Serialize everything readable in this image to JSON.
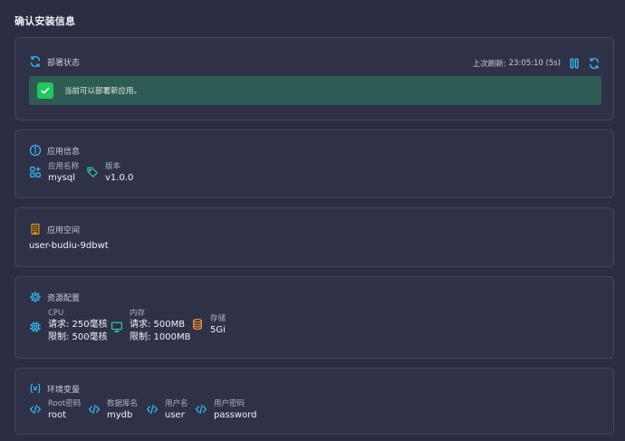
{
  "page": {
    "title": "确认安装信息"
  },
  "deploy_status": {
    "title": "部署状态",
    "last_refresh_label": "上次刷新:",
    "last_refresh_time": "23:05:10 (5s)",
    "message": "当前可以部署新应用。"
  },
  "app_info": {
    "title": "应用信息",
    "name_label": "应用名称",
    "name_value": "mysql",
    "version_label": "版本",
    "version_value": "v1.0.0"
  },
  "namespace": {
    "title": "应用空间",
    "value": "user-budiu-9dbwt"
  },
  "resources": {
    "title": "资源配置",
    "cpu_label": "CPU",
    "cpu_request": "请求: 250毫核",
    "cpu_limit": "限制: 500毫核",
    "mem_label": "内存",
    "mem_request": "请求: 500MB",
    "mem_limit": "限制: 1000MB",
    "storage_label": "存储",
    "storage_value": "5Gi"
  },
  "env": {
    "title": "环境变量",
    "vars": [
      {
        "label": "Root密码",
        "value": "root"
      },
      {
        "label": "数据库名",
        "value": "mydb"
      },
      {
        "label": "用户名",
        "value": "user"
      },
      {
        "label": "用户密码",
        "value": "password"
      }
    ]
  },
  "colors": {
    "background": "#2b2d42",
    "card": "#2f3148",
    "accent_blue": "#38bdf8",
    "success_green": "#22c55e",
    "banner_bg": "#2f5b55",
    "storage_orange": "#fb923c",
    "namespace_orange": "#f59e0b",
    "monitor_green": "#34d399"
  }
}
